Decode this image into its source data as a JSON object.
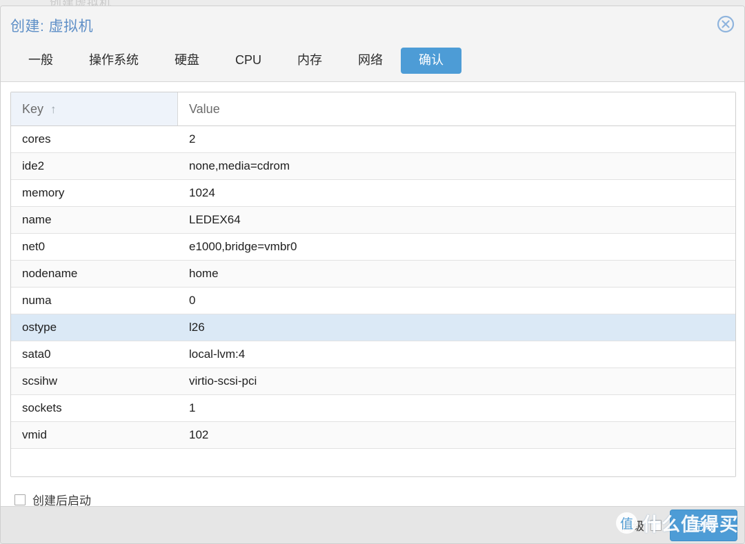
{
  "background": {
    "ghost_text": "创建虚拟机"
  },
  "dialog": {
    "title": "创建: 虚拟机",
    "close_icon": "close-circle-icon",
    "tabs": [
      {
        "label": "一般",
        "active": false
      },
      {
        "label": "操作系统",
        "active": false
      },
      {
        "label": "硬盘",
        "active": false
      },
      {
        "label": "CPU",
        "active": false
      },
      {
        "label": "内存",
        "active": false
      },
      {
        "label": "网络",
        "active": false
      },
      {
        "label": "确认",
        "active": true
      }
    ],
    "active_tab": "确认"
  },
  "grid": {
    "columns": [
      {
        "key": "key",
        "label": "Key",
        "sorted": true,
        "sort_direction": "asc",
        "sort_icon": "arrow-up-icon"
      },
      {
        "key": "value",
        "label": "Value",
        "sorted": false
      }
    ],
    "rows": [
      {
        "key": "cores",
        "value": "2",
        "selected": false
      },
      {
        "key": "ide2",
        "value": "none,media=cdrom",
        "selected": false
      },
      {
        "key": "memory",
        "value": "1024",
        "selected": false
      },
      {
        "key": "name",
        "value": "LEDEX64",
        "selected": false
      },
      {
        "key": "net0",
        "value": "e1000,bridge=vmbr0",
        "selected": false
      },
      {
        "key": "nodename",
        "value": "home",
        "selected": false
      },
      {
        "key": "numa",
        "value": "0",
        "selected": false
      },
      {
        "key": "ostype",
        "value": "l26",
        "selected": true
      },
      {
        "key": "sata0",
        "value": "local-lvm:4",
        "selected": false
      },
      {
        "key": "scsihw",
        "value": "virtio-scsi-pci",
        "selected": false
      },
      {
        "key": "sockets",
        "value": "1",
        "selected": false
      },
      {
        "key": "vmid",
        "value": "102",
        "selected": false
      }
    ]
  },
  "options": {
    "start_after_create_label": "创建后启动",
    "start_after_create_checked": false
  },
  "footer": {
    "advanced_label": "高级",
    "advanced_checked": false,
    "finish_label": "完成"
  },
  "watermark": {
    "badge": "值",
    "text": "什么值得买"
  },
  "colors": {
    "accent": "#4d9cd6",
    "title": "#5e8fc7",
    "selected_row": "#dbe9f6",
    "sorted_header": "#eef3fa",
    "footer_bg": "#e6e6e6",
    "header_bg": "#f4f4f4"
  }
}
